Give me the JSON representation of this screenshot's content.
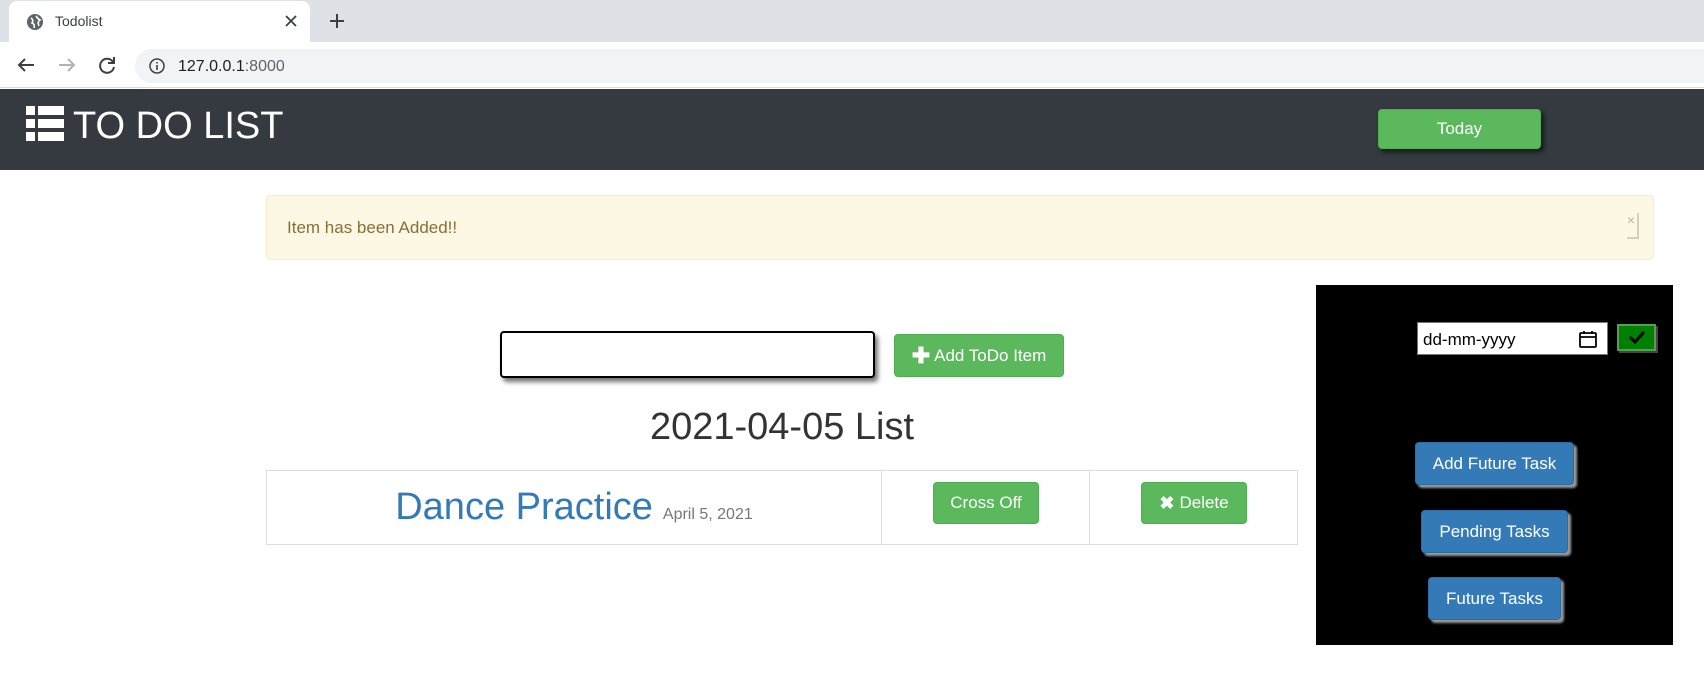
{
  "browser": {
    "tab_title": "Todolist",
    "url_host": "127.0.0.1",
    "url_port": ":8000"
  },
  "navbar": {
    "brand": "TO DO LIST",
    "today_label": "Today"
  },
  "alert": {
    "message": "Item has been Added!!",
    "close": "×"
  },
  "form": {
    "input_value": "",
    "add_label": "Add ToDo Item"
  },
  "list": {
    "title": "2021-04-05 List",
    "items": [
      {
        "name": "Dance Practice",
        "date": "April 5, 2021",
        "cross_label": "Cross Off",
        "delete_label": "Delete"
      }
    ]
  },
  "side_panel": {
    "date_placeholder": "dd-mm-yyyy",
    "add_future_label": "Add Future Task",
    "pending_label": "Pending Tasks",
    "future_label": "Future Tasks"
  },
  "colors": {
    "navbar": "#343a40",
    "success": "#5cb85c",
    "primary": "#337ab7",
    "alert_bg": "#fcf8e3"
  }
}
